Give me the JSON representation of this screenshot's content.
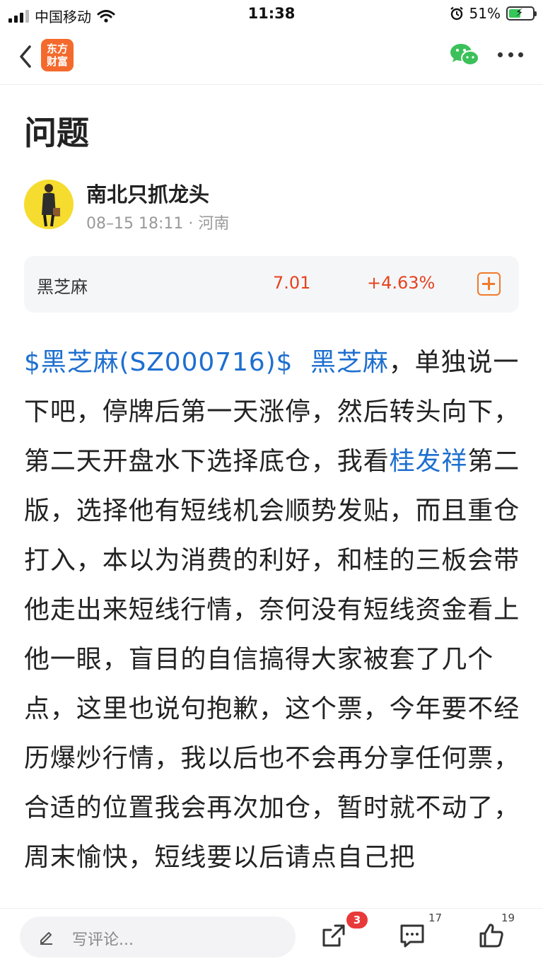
{
  "status_bar": {
    "carrier": "中国移动",
    "time": "11:38",
    "battery": "51%",
    "battery_level": 0.51
  },
  "nav": {
    "logo_text": "东方财富",
    "icons": [
      "back-icon",
      "wechat-icon",
      "more-icon"
    ]
  },
  "post": {
    "title": "问题",
    "author": "南北只抓龙头",
    "meta": "08–15 18:11 · 河南"
  },
  "stock": {
    "name": "黑芝麻",
    "price": "7.01",
    "change": "+4.63%",
    "color": "#e5431f"
  },
  "article": {
    "link_stock": "$黑芝麻(SZ000716)$",
    "link_name": "黑芝麻",
    "text_1": "，单独说一下吧，停牌后第一天涨停，然后转头向下，第二天开盘水下选择底仓，我看",
    "link_person": "桂发祥",
    "text_2": "第二版，选择他有短线机会顺势发贴，而且重仓打入，本以为消费的利好，和桂的三板会带他走出来短线行情，奈何没有短线资金看上他一眼，盲目的自信搞得大家被套了几个点，这里也说句抱歉，这个票，今年要不经历爆炒行情，我以后也不会再分享任何票，合适的位置我会再次加仓，暂时就不动了，周末愉快，短线要以后请点自己把",
    "link_color": "#1e6fd0"
  },
  "bottom_bar": {
    "comment_placeholder": "写评论...",
    "share_badge": "3",
    "comment_count": "17",
    "like_count": "19"
  }
}
